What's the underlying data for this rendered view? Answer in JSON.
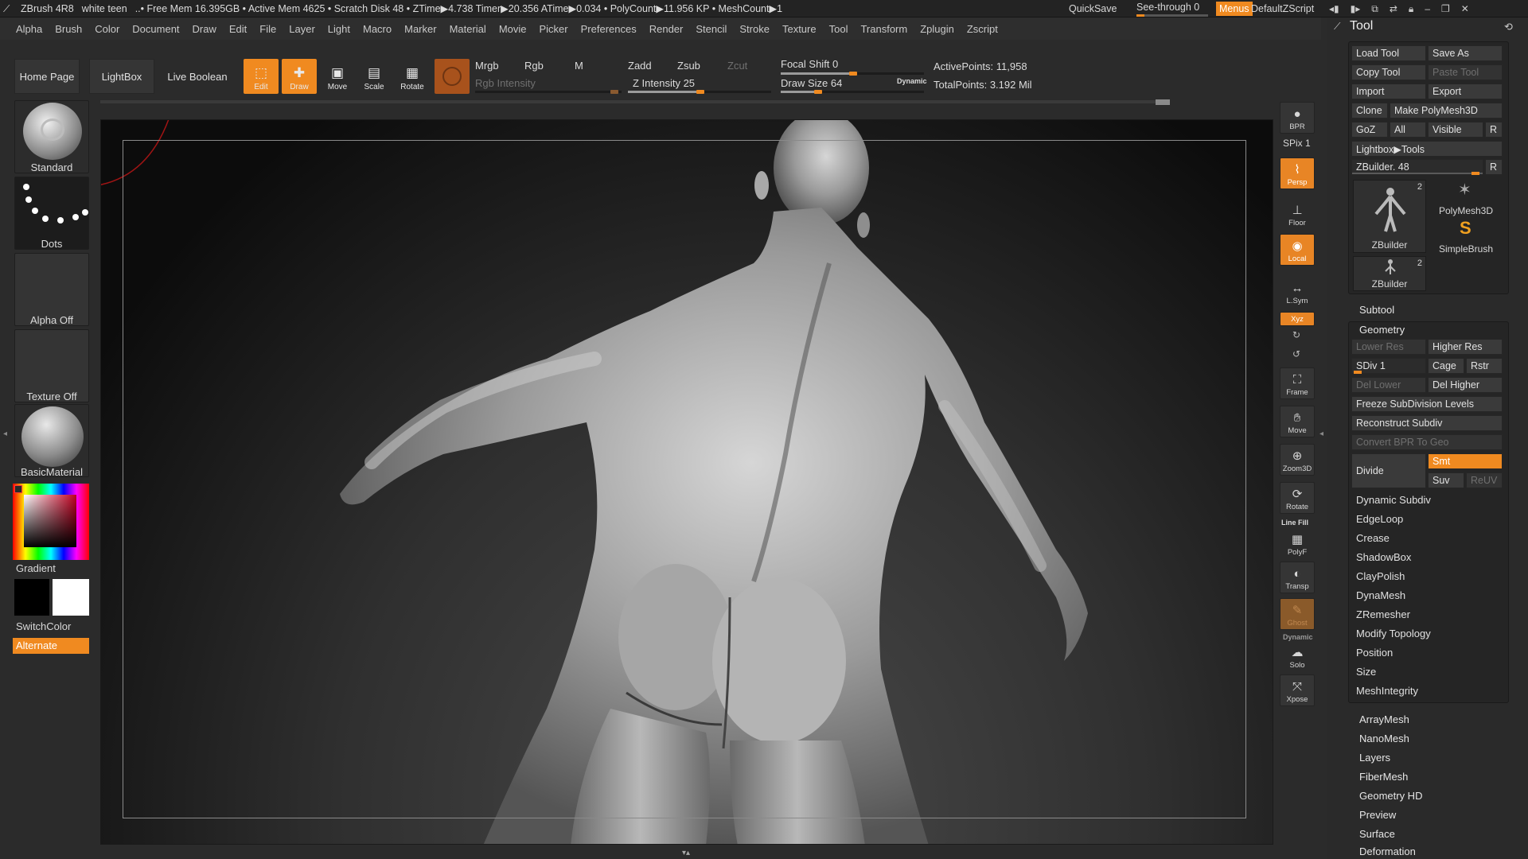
{
  "titlebar": {
    "app": "ZBrush 4R8",
    "document": "white teen",
    "stats": "..• Free Mem 16.395GB • Active Mem 4625 • Scratch Disk 48 • ZTime▶4.738 Timer▶20.356 ATime▶0.034 • PolyCount▶11.956 KP • MeshCount▶1",
    "quicksave": "QuickSave",
    "see_through": "See-through  0",
    "menus": "Menus",
    "default_script": "DefaultZScript"
  },
  "menubar": [
    "Alpha",
    "Brush",
    "Color",
    "Document",
    "Draw",
    "Edit",
    "File",
    "Layer",
    "Light",
    "Macro",
    "Marker",
    "Material",
    "Movie",
    "Picker",
    "Preferences",
    "Render",
    "Stencil",
    "Stroke",
    "Texture",
    "Tool",
    "Transform",
    "Zplugin",
    "Zscript"
  ],
  "shelf": {
    "home_page": "Home Page",
    "lightbox": "LightBox",
    "live_boolean": "Live Boolean",
    "tools": [
      {
        "label": "Edit",
        "on": true
      },
      {
        "label": "Draw",
        "on": true
      },
      {
        "label": "Move",
        "on": false
      },
      {
        "label": "Scale",
        "on": false
      },
      {
        "label": "Rotate",
        "on": false
      }
    ],
    "mrgb": "Mrgb",
    "rgb": "Rgb",
    "m": "M",
    "rgb_intensity": "Rgb Intensity",
    "zadd": "Zadd",
    "zsub": "Zsub",
    "zcut": "Zcut",
    "z_intensity": "Z Intensity 25",
    "focal_shift": "Focal Shift 0",
    "draw_size": "Draw Size 64",
    "dynamic": "Dynamic",
    "active_points": "ActivePoints: 11,958",
    "total_points": "TotalPoints: 3.192 Mil"
  },
  "lefttray": {
    "brush": "Standard",
    "stroke": "Dots",
    "alpha": "Alpha Off",
    "texture": "Texture Off",
    "material": "BasicMaterial",
    "gradient": "Gradient",
    "switch_color": "SwitchColor",
    "alternate": "Alternate"
  },
  "rightshelf": [
    {
      "label": "BPR",
      "icon": "bpr-icon"
    },
    {
      "label": "SPix 1",
      "icon": ""
    },
    {
      "label": "Persp",
      "icon": "persp-icon",
      "on": true
    },
    {
      "label": "Floor",
      "icon": "floor-icon"
    },
    {
      "label": "Local",
      "icon": "local-icon",
      "on": true
    },
    {
      "label": "L.Sym",
      "icon": "lsym-icon"
    },
    {
      "label": "Xyz",
      "icon": "xyz-icon",
      "on": true
    },
    {
      "label": "Frame",
      "icon": "frame-icon"
    },
    {
      "label": "Move",
      "icon": "move-icon"
    },
    {
      "label": "Zoom3D",
      "icon": "zoom-icon"
    },
    {
      "label": "Rotate",
      "icon": "rotate-icon"
    },
    {
      "label": "PolyF",
      "icon": "polyf-icon",
      "top": "Line Fill"
    },
    {
      "label": "Transp",
      "icon": "transp-icon"
    },
    {
      "label": "Ghost",
      "icon": "ghost-icon",
      "on": true
    },
    {
      "label": "Solo",
      "icon": "solo-icon",
      "top": "Dynamic"
    },
    {
      "label": "Xpose",
      "icon": "xpose-icon"
    }
  ],
  "palette": {
    "title": "Tool",
    "load_tool": "Load Tool",
    "save_as": "Save As",
    "copy_tool": "Copy Tool",
    "paste_tool": "Paste Tool",
    "import": "Import",
    "export": "Export",
    "clone": "Clone",
    "make_polymesh": "Make PolyMesh3D",
    "goz": "GoZ",
    "all": "All",
    "visible": "Visible",
    "r": "R",
    "lightbox_tools": "Lightbox▶Tools",
    "zbuilder_slider": "ZBuilder. 48",
    "thumbs": [
      {
        "label": "ZBuilder",
        "count": "2"
      },
      {
        "label": "PolyMesh3D",
        "count": ""
      },
      {
        "label": "SimpleBrush",
        "count": ""
      },
      {
        "label": "ZBuilder",
        "count": "2"
      }
    ],
    "subtool": "Subtool",
    "geometry": "Geometry",
    "lower_res": "Lower Res",
    "higher_res": "Higher Res",
    "sdiv": "SDiv 1",
    "cage": "Cage",
    "rstr": "Rstr",
    "del_lower": "Del Lower",
    "del_higher": "Del Higher",
    "freeze": "Freeze SubDivision Levels",
    "reconstruct": "Reconstruct Subdiv",
    "convert_bpr": "Convert BPR To Geo",
    "divide": "Divide",
    "smt": "Smt",
    "suv": "Suv",
    "reuv": "ReUV",
    "geometry_items": [
      "Dynamic Subdiv",
      "EdgeLoop",
      "Crease",
      "ShadowBox",
      "ClayPolish",
      "DynaMesh",
      "ZRemesher",
      "Modify Topology",
      "Position",
      "Size",
      "MeshIntegrity"
    ],
    "sections": [
      "ArrayMesh",
      "NanoMesh",
      "Layers",
      "FiberMesh",
      "Geometry HD",
      "Preview",
      "Surface",
      "Deformation"
    ]
  }
}
